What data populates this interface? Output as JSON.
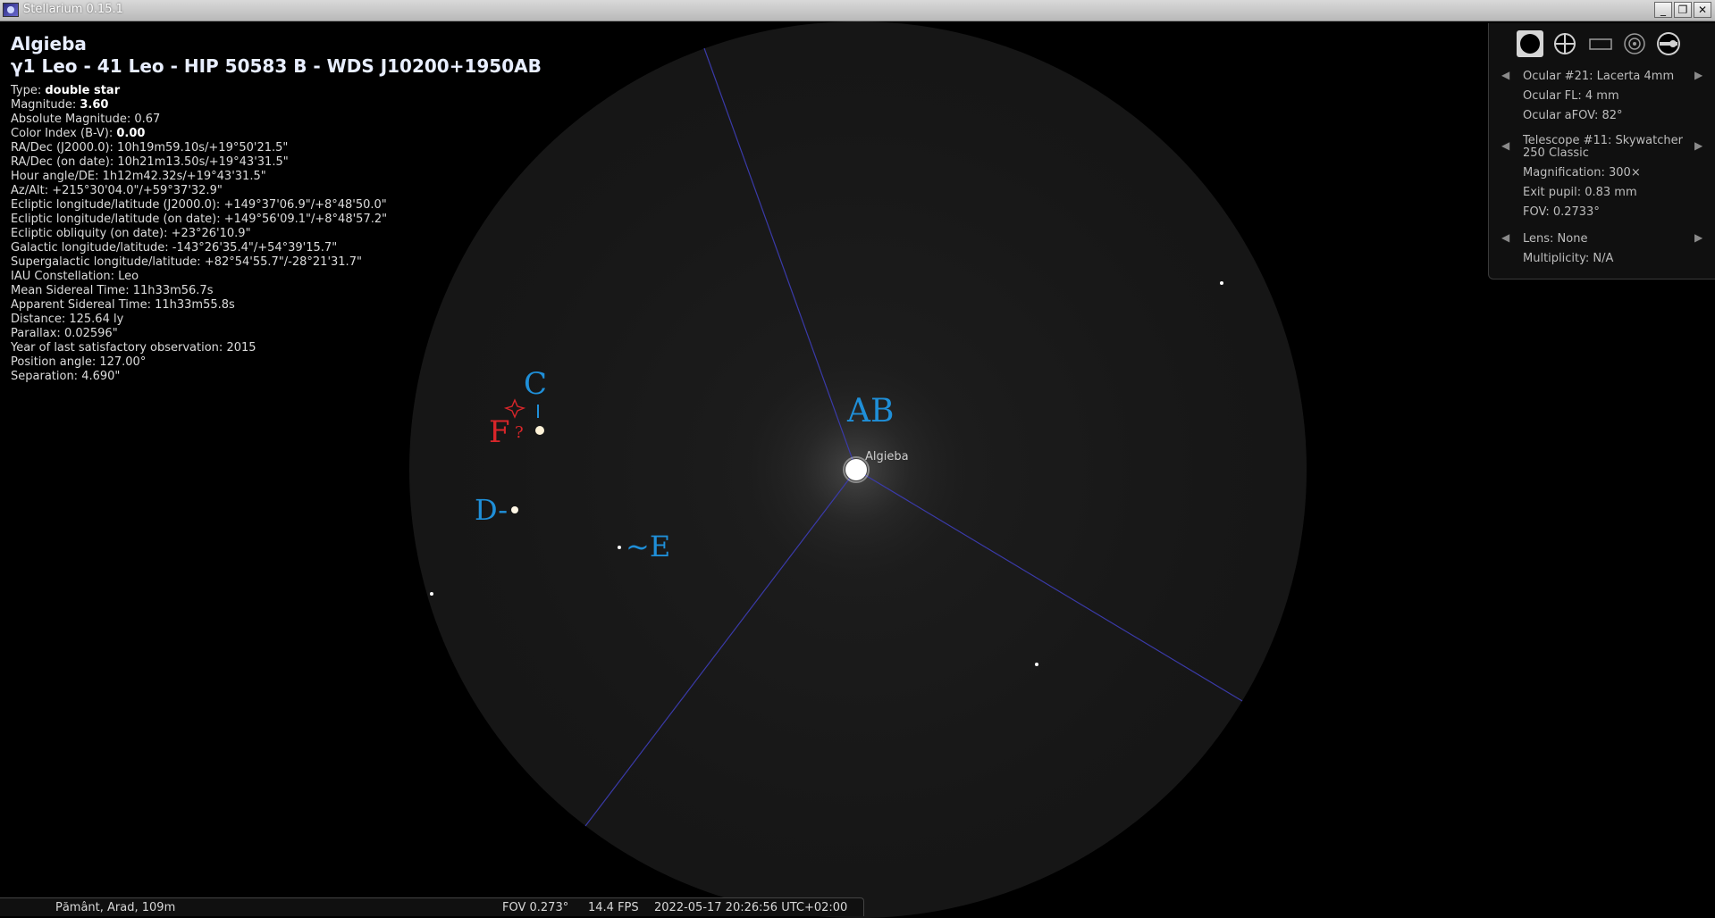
{
  "window": {
    "title": "Stellarium 0.15.1",
    "buttons": {
      "minimize": "_",
      "restore": "❐",
      "close": "✕"
    }
  },
  "object": {
    "name": "Algieba",
    "ids": "γ1 Leo - 41 Leo - HIP 50583 B - WDS J10200+1950AB",
    "rows": [
      {
        "label": "Type: ",
        "value": "double star",
        "bold": true
      },
      {
        "label": "Magnitude: ",
        "value": "3.60",
        "bold": true
      },
      {
        "label": "Absolute Magnitude: ",
        "value": "0.67"
      },
      {
        "label": "Color Index (B-V): ",
        "value": "0.00",
        "bold": true
      },
      {
        "label": "RA/Dec (J2000.0): ",
        "value": "10h19m59.10s/+19°50'21.5\""
      },
      {
        "label": "RA/Dec (on date): ",
        "value": "10h21m13.50s/+19°43'31.5\""
      },
      {
        "label": "Hour angle/DE: ",
        "value": "1h12m42.32s/+19°43'31.5\""
      },
      {
        "label": "Az/Alt: ",
        "value": "+215°30'04.0\"/+59°37'32.9\""
      },
      {
        "label": "Ecliptic longitude/latitude (J2000.0): ",
        "value": "+149°37'06.9\"/+8°48'50.0\""
      },
      {
        "label": "Ecliptic longitude/latitude (on date): ",
        "value": "+149°56'09.1\"/+8°48'57.2\""
      },
      {
        "label": "Ecliptic obliquity (on date): ",
        "value": "+23°26'10.9\""
      },
      {
        "label": "Galactic longitude/latitude: ",
        "value": "-143°26'35.4\"/+54°39'15.7\""
      },
      {
        "label": "Supergalactic longitude/latitude: ",
        "value": "+82°54'55.7\"/-28°21'31.7\""
      },
      {
        "label": "IAU Constellation: ",
        "value": "Leo"
      },
      {
        "label": "Mean Sidereal Time: ",
        "value": "11h33m56.7s"
      },
      {
        "label": "Apparent Sidereal Time: ",
        "value": "11h33m55.8s"
      },
      {
        "label": "Distance: ",
        "value": "125.64 ly"
      },
      {
        "label": "Parallax: ",
        "value": "0.02596\""
      },
      {
        "label": "Year of last satisfactory observation: ",
        "value": "2015"
      },
      {
        "label": "Position angle: ",
        "value": "127.00°"
      },
      {
        "label": "Separation: ",
        "value": "4.690\""
      }
    ]
  },
  "sky": {
    "star_label": "Algieba",
    "annotations": {
      "ab": "AB",
      "c": "C",
      "f": "F",
      "f_q": "?",
      "d": "D-",
      "e": "~E"
    },
    "annotation_colors": {
      "blue": "#1f8fd8",
      "red": "#d8262a"
    }
  },
  "ocular_panel": {
    "tools": [
      "ocular-view-icon",
      "crosshair-icon",
      "ccd-frame-icon",
      "telrad-icon",
      "settings-icon"
    ],
    "ocular": {
      "name": "Ocular #21: Lacerta 4mm",
      "fl": "Ocular FL: 4 mm",
      "afov": "Ocular aFOV: 82°"
    },
    "telescope": {
      "name_line1": "Telescope #11: Skywatcher",
      "name_line2": "250 Classic",
      "magnification": "Magnification: 300×",
      "exit_pupil": "Exit pupil: 0.83 mm",
      "fov": "FOV: 0.2733°"
    },
    "lens": {
      "name": "Lens: None",
      "multiplicity": "Multiplicity: N/A"
    }
  },
  "status": {
    "location": "Pământ, Arad, 109m",
    "fov": "FOV 0.273°",
    "fps": "14.4 FPS",
    "datetime": "2022-05-17 20:26:56 UTC+02:00"
  }
}
